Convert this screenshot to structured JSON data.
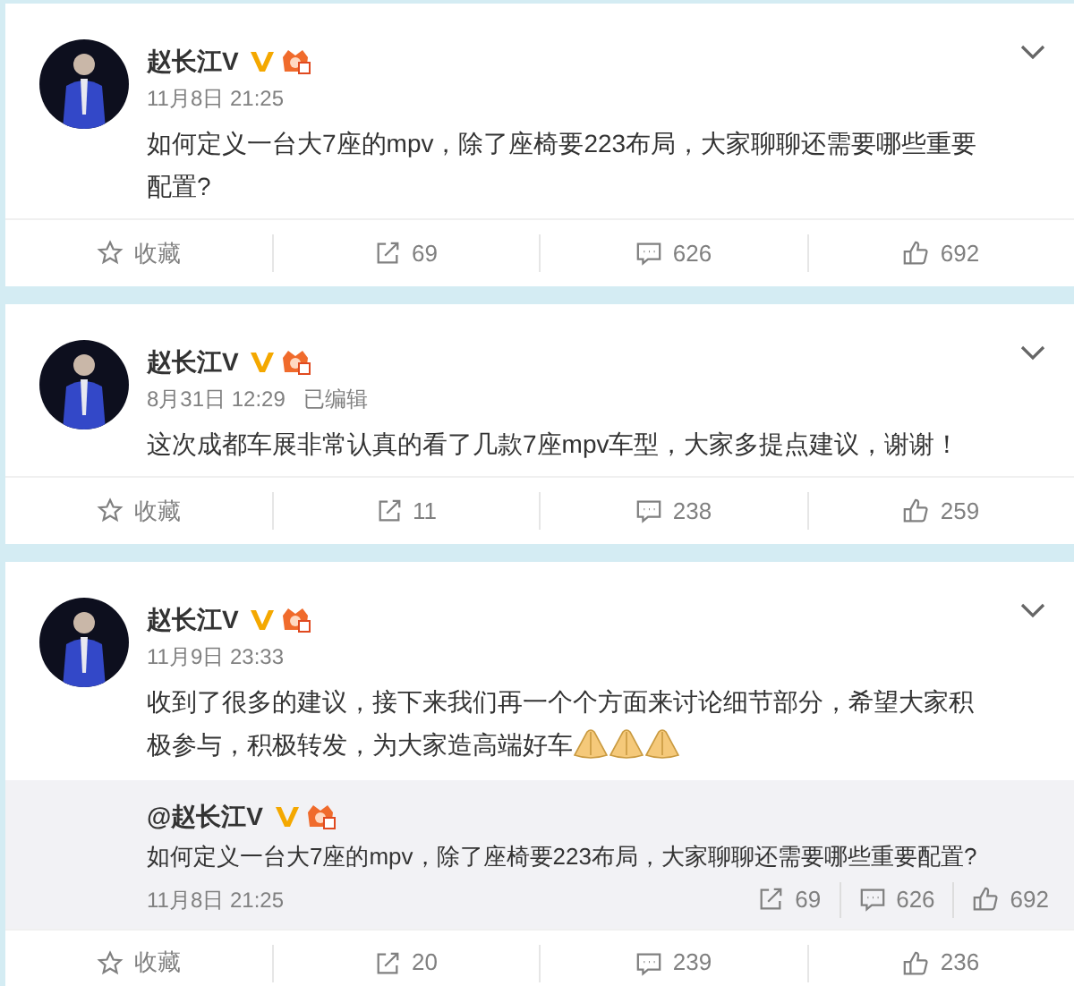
{
  "posts": [
    {
      "author": "赵长江V",
      "time": "11月8日 21:25",
      "text": "如何定义一台大7座的mpv，除了座椅要223布局，大家聊聊还需要哪些重要配置?",
      "actions": [
        {
          "kind": "favorite",
          "label": "收藏"
        },
        {
          "kind": "repost",
          "label": "69"
        },
        {
          "kind": "comment",
          "label": "626"
        },
        {
          "kind": "like",
          "label": "692"
        }
      ]
    },
    {
      "author": "赵长江V",
      "time": "8月31日 12:29",
      "edit_note": "已编辑",
      "text": "这次成都车展非常认真的看了几款7座mpv车型，大家多提点建议，谢谢！",
      "actions": [
        {
          "kind": "favorite",
          "label": "收藏"
        },
        {
          "kind": "repost",
          "label": "11"
        },
        {
          "kind": "comment",
          "label": "238"
        },
        {
          "kind": "like",
          "label": "259"
        }
      ]
    },
    {
      "author": "赵长江V",
      "time": "11月9日 23:33",
      "text": "收到了很多的建议，接下来我们再一个个方面来讨论细节部分，希望大家积极参与，积极转发，为大家造高端好车",
      "emojis": [
        {
          "kind": "pray"
        },
        {
          "kind": "pray"
        },
        {
          "kind": "pray"
        }
      ],
      "quoted": {
        "author": "@赵长江V",
        "text": "如何定义一台大7座的mpv，除了座椅要223布局，大家聊聊还需要哪些重要配置?",
        "time": "11月8日 21:25",
        "actions": [
          {
            "kind": "repost",
            "label": "69"
          },
          {
            "kind": "comment",
            "label": "626"
          },
          {
            "kind": "like",
            "label": "692"
          }
        ]
      },
      "actions": [
        {
          "kind": "favorite",
          "label": "收藏"
        },
        {
          "kind": "repost",
          "label": "20"
        },
        {
          "kind": "comment",
          "label": "239"
        },
        {
          "kind": "like",
          "label": "236"
        }
      ]
    }
  ]
}
